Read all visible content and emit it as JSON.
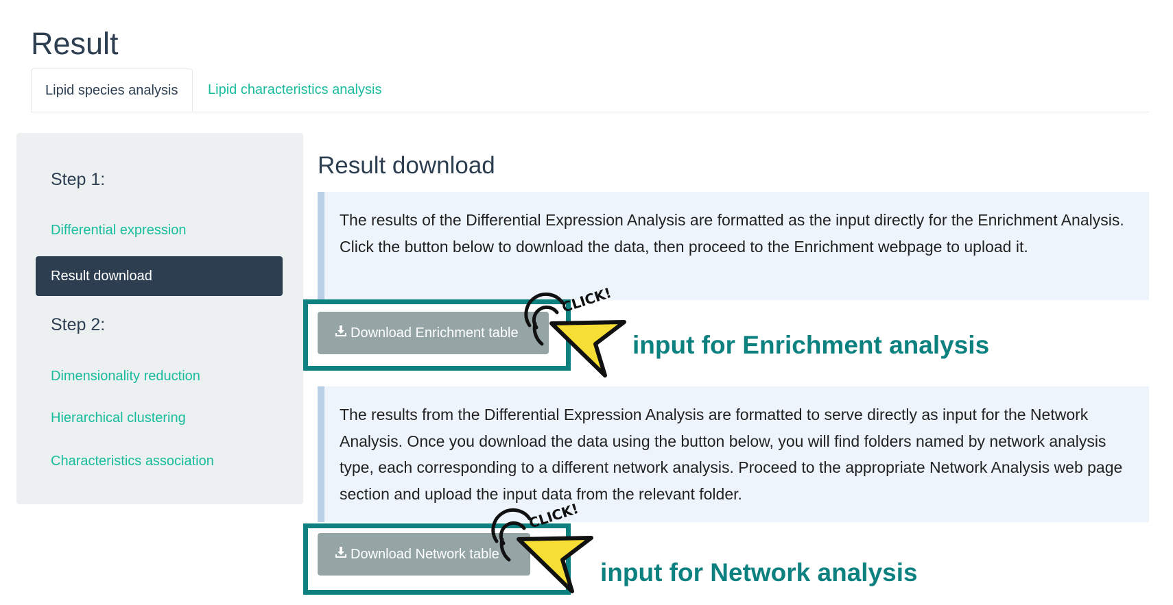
{
  "page_title": "Result",
  "tabs": [
    {
      "label": "Lipid species analysis",
      "active": true
    },
    {
      "label": "Lipid characteristics analysis",
      "active": false
    }
  ],
  "sidebar": {
    "step1_label": "Step 1:",
    "step1_items": [
      "Differential expression",
      "Result download"
    ],
    "active_item": "Result download",
    "step2_label": "Step 2:",
    "step2_items": [
      "Dimensionality reduction",
      "Hierarchical clustering",
      "Characteristics association"
    ]
  },
  "main": {
    "section_title": "Result download",
    "enrichment_info": "The results of the Differential Expression Analysis are formatted as the input directly for the Enrichment Analysis. Click the button below to download the data, then proceed to the Enrichment webpage to upload it.",
    "enrichment_button": "Download Enrichment table",
    "network_info": "The results from the Differential Expression Analysis are formatted to serve directly as input for the Network Analysis. Once you download the data using the button below, you will find folders named by network analysis type, each corresponding to a different network analysis. Proceed to the appropriate Network Analysis web page section and upload the input data from the relevant folder.",
    "network_button": "Download Network table"
  },
  "annotations": {
    "click_badge": "CLICK!",
    "enrichment_note": "input for Enrichment analysis",
    "network_note": "input for Network analysis"
  },
  "colors": {
    "primary": "#2c3e50",
    "accent": "#18bc9c",
    "sidebar_bg": "#ecf0f1",
    "button_bg": "#95a5a6",
    "info_bg": "#eef4fc",
    "highlight": "#0d8080",
    "cursor": "#f7de35"
  },
  "icons": [
    "download-icon",
    "pointer-cursor-icon"
  ]
}
